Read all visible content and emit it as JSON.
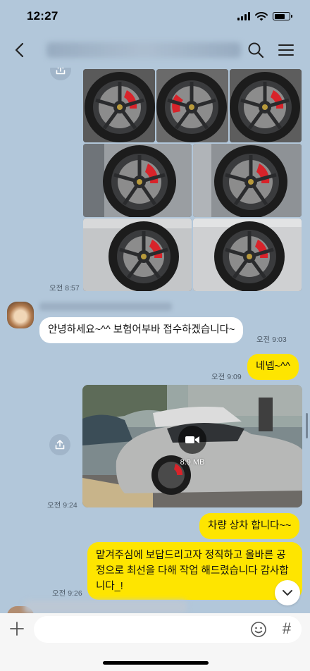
{
  "status_bar": {
    "time": "12:27"
  },
  "header": {
    "title": "████████████████████"
  },
  "messages": {
    "photos_time": "오전 8:57",
    "greeting": {
      "sender": "██████████████",
      "text": "안녕하세요~^^ 보험어부바 접수하겠습니다~",
      "time": "오전 9:03"
    },
    "reply1": {
      "text": "네넵~^^",
      "time": "오전 9:09"
    },
    "video": {
      "size": "8.9 MB",
      "time": "오전 9:24"
    },
    "reply2": {
      "text": "차량 상차 합니다~~"
    },
    "reply3": {
      "line1": "맡겨주심에 보답드리고자 정직하고 올바른 공",
      "line2": "정으로 최선을 다해 작업 해드렸습니다 감사합",
      "line3": "니다_!",
      "time": "오전 9:26"
    }
  },
  "input_bar": {
    "placeholder": "",
    "hash_label": "#"
  },
  "colors": {
    "chat_background": "#b2c7da",
    "outgoing_bubble": "#fee500",
    "incoming_bubble": "#ffffff",
    "brake_caliper": "#d8232a"
  },
  "icons": [
    "back-icon",
    "search-icon",
    "menu-icon",
    "share-icon",
    "video-play-icon",
    "chevron-down-icon",
    "plus-icon",
    "emoji-icon"
  ]
}
